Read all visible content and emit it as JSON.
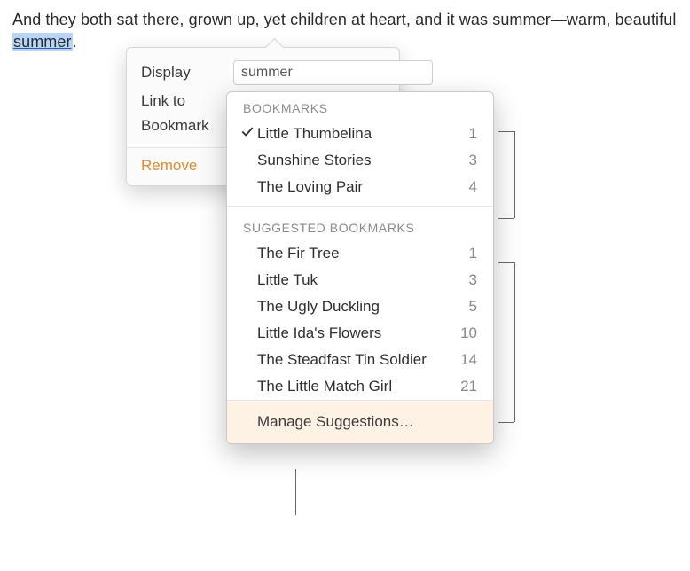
{
  "document": {
    "sentence_pre": "And they both sat there, grown up, yet children at heart, and it was summer—warm, beautiful ",
    "linked_word": "summer",
    "sentence_post": "."
  },
  "popover": {
    "display_label": "Display",
    "display_value": "summer",
    "linkto_label": "Link to",
    "bookmark_label": "Bookmark",
    "remove_label": "Remove"
  },
  "dropdown": {
    "bookmarks_header": "BOOKMARKS",
    "bookmarks": [
      {
        "name": "Little Thumbelina",
        "count": "1",
        "selected": true
      },
      {
        "name": "Sunshine Stories",
        "count": "3",
        "selected": false
      },
      {
        "name": "The Loving Pair",
        "count": "4",
        "selected": false
      }
    ],
    "suggested_header": "SUGGESTED BOOKMARKS",
    "suggested": [
      {
        "name": "The Fir Tree",
        "count": "1"
      },
      {
        "name": "Little Tuk",
        "count": "3"
      },
      {
        "name": "The Ugly Duckling",
        "count": "5"
      },
      {
        "name": "Little Ida's Flowers",
        "count": "10"
      },
      {
        "name": "The Steadfast Tin Soldier",
        "count": "14"
      },
      {
        "name": "The Little Match Girl",
        "count": "21"
      }
    ],
    "manage_label": "Manage Suggestions…"
  }
}
